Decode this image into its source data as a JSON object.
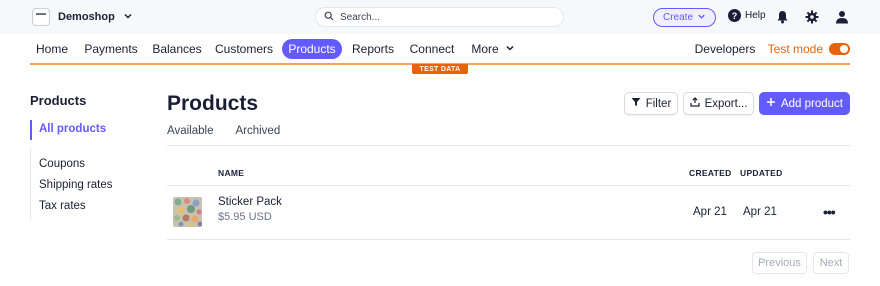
{
  "account": {
    "name": "Demoshop",
    "logo_icon": "store-icon",
    "chevron_icon": "chevron-down-icon"
  },
  "search": {
    "placeholder": "Search...",
    "icon": "search-icon"
  },
  "topbar": {
    "create_label": "Create",
    "help_label": "Help",
    "icons": [
      "bell-icon",
      "gear-icon",
      "user-icon"
    ]
  },
  "nav": {
    "items": [
      "Home",
      "Payments",
      "Balances",
      "Customers",
      "Products",
      "Reports",
      "Connect",
      "More"
    ],
    "active": "Products",
    "developers_label": "Developers",
    "test_mode_label": "Test mode",
    "test_mode_on": true
  },
  "test_data_label": "TEST DATA",
  "sidebar": {
    "title": "Products",
    "items": [
      "All products",
      "Coupons",
      "Shipping rates",
      "Tax rates"
    ],
    "active": "All products"
  },
  "page": {
    "title": "Products",
    "filter_label": "Filter",
    "export_label": "Export...",
    "add_label": "Add product",
    "tabs": [
      "Available",
      "Archived"
    ]
  },
  "table": {
    "headers": {
      "name": "NAME",
      "created": "CREATED",
      "updated": "UPDATED"
    },
    "rows": [
      {
        "name": "Sticker Pack",
        "price": "$5.95 USD",
        "created": "Apr 21",
        "updated": "Apr 21"
      }
    ]
  },
  "pagination": {
    "previous_label": "Previous",
    "next_label": "Next"
  },
  "colors": {
    "accent": "#635bff",
    "test_mode": "#e5630a",
    "topbar_bg": "#f6f8fa"
  }
}
